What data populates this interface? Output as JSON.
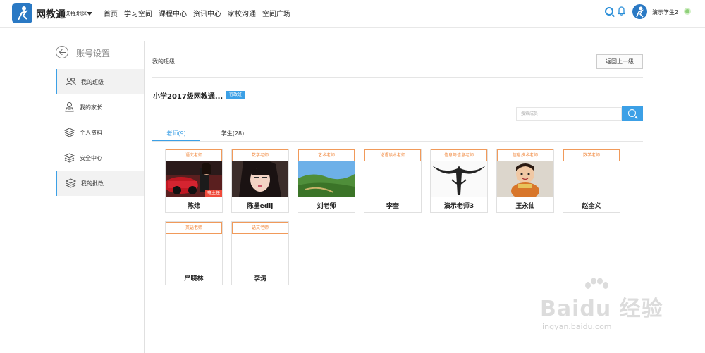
{
  "header": {
    "brand": "网教通",
    "region": "选择地区",
    "nav": [
      "首页",
      "学习空间",
      "课程中心",
      "资讯中心",
      "家校沟通",
      "空间广场"
    ],
    "username": "演示学生2"
  },
  "sidebar": {
    "title": "账号设置",
    "items": [
      {
        "label": "我的班级",
        "icon": "users-icon",
        "active": true
      },
      {
        "label": "我的家长",
        "icon": "parent-icon",
        "active": false
      },
      {
        "label": "个人资料",
        "icon": "stack-icon",
        "active": false
      },
      {
        "label": "安全中心",
        "icon": "stack-icon",
        "active": false
      },
      {
        "label": "我的批改",
        "icon": "stack-icon",
        "active": true
      }
    ]
  },
  "main": {
    "breadcrumb": "我的班级",
    "back_button": "返回上一级",
    "class_name": "小学2017级网教通...",
    "class_tag": "行政班",
    "search_placeholder": "搜索成员",
    "tabs": [
      {
        "label": "老师(9)",
        "active": true
      },
      {
        "label": "学生(28)",
        "active": false
      }
    ],
    "teachers": [
      {
        "role": "语文老师",
        "name": "陈炜",
        "badge": "班主任",
        "photo": "car"
      },
      {
        "role": "数学老师",
        "name": "陈墨edij",
        "badge": "",
        "photo": "girl"
      },
      {
        "role": "艺术老师",
        "name": "刘老师",
        "badge": "",
        "photo": "landscape"
      },
      {
        "role": "论语读本老师",
        "name": "李奎",
        "badge": "",
        "photo": "blank"
      },
      {
        "role": "信息与信息老师",
        "name": "演示老师3",
        "badge": "",
        "photo": "tribal"
      },
      {
        "role": "信息技术老师",
        "name": "王永仙",
        "badge": "",
        "photo": "doll"
      },
      {
        "role": "数学老师",
        "name": "赵全义",
        "badge": "",
        "photo": "blank"
      },
      {
        "role": "英语老师",
        "name": "严晓林",
        "badge": "",
        "photo": "blank"
      },
      {
        "role": "语文老师",
        "name": "李涛",
        "badge": "",
        "photo": "blank"
      }
    ]
  },
  "watermark": {
    "big": "Baidu 经验",
    "small": "jingyan.baidu.com"
  },
  "colors": {
    "accent": "#3ca0e6",
    "role_border": "#f19a5a",
    "badge": "#f04a3a"
  }
}
